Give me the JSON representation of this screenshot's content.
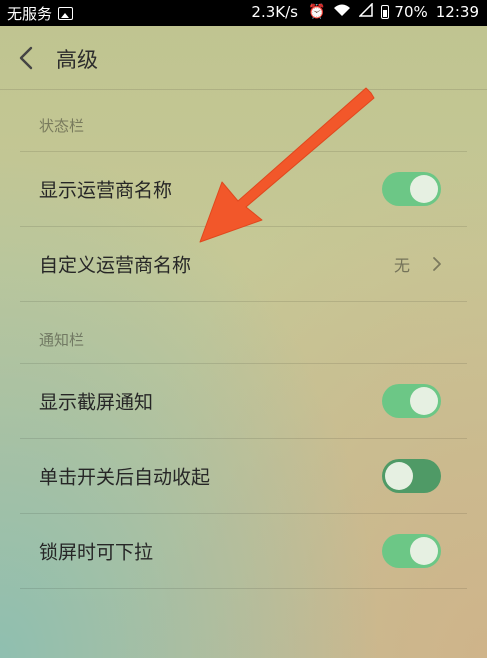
{
  "statusbar": {
    "carrier": "无服务",
    "speed": "2.3K/s",
    "alarm_icon": "alarm-icon",
    "wifi_icon": "wifi-icon",
    "battery_percent": "70%",
    "time": "12:39"
  },
  "header": {
    "title": "高级",
    "back_icon": "back-arrow-icon"
  },
  "sections": [
    {
      "label": "状态栏",
      "rows": [
        {
          "label": "显示运营商名称",
          "type": "toggle",
          "on": true
        },
        {
          "label": "自定义运营商名称",
          "type": "value",
          "value": "无"
        }
      ]
    },
    {
      "label": "通知栏",
      "rows": [
        {
          "label": "显示截屏通知",
          "type": "toggle",
          "on": true
        },
        {
          "label": "单击开关后自动收起",
          "type": "toggle",
          "on": false
        },
        {
          "label": "锁屏时可下拉",
          "type": "toggle",
          "on": true
        }
      ]
    }
  ],
  "colors": {
    "toggle_on": "#6cc786",
    "toggle_off": "#4f9a66",
    "annotation_arrow": "#f2572a"
  }
}
